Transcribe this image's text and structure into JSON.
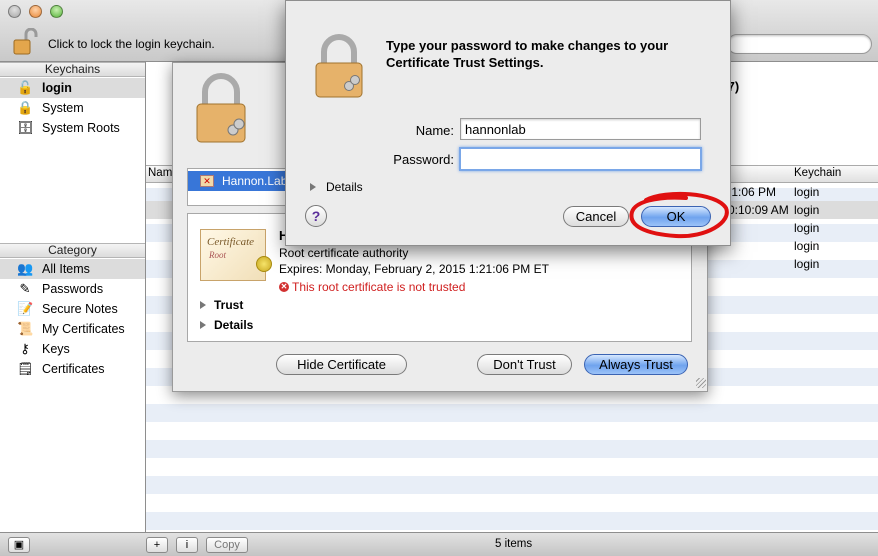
{
  "window": {
    "lock_text": "Click to lock the login keychain.",
    "bottom_status": "5 items",
    "copy_label": "Copy",
    "add_label": "+",
    "info_label": "i"
  },
  "sidebar": {
    "keychains_header": "Keychains",
    "keychains": [
      {
        "label": "login",
        "icon": "unlocked-lock-icon",
        "selected": true
      },
      {
        "label": "System",
        "icon": "lock-icon"
      },
      {
        "label": "System Roots",
        "icon": "cabinet-icon"
      }
    ],
    "category_header": "Category",
    "categories": [
      {
        "label": "All Items",
        "icon": "people-icon",
        "selected": true
      },
      {
        "label": "Passwords",
        "icon": "key-pencil-icon"
      },
      {
        "label": "Secure Notes",
        "icon": "note-icon"
      },
      {
        "label": "My Certificates",
        "icon": "certificate-icon"
      },
      {
        "label": "Keys",
        "icon": "key-icon"
      },
      {
        "label": "Certificates",
        "icon": "certificate-list-icon"
      }
    ]
  },
  "list": {
    "columns": {
      "name": "Nam",
      "keychain": "Keychain"
    },
    "bg_title_right": "E7)",
    "rows": [
      {
        "date": ":1:06 PM",
        "keychain": "login"
      },
      {
        "date": "0:10:09 AM",
        "keychain": "login"
      },
      {
        "date": "",
        "keychain": "login"
      },
      {
        "date": "",
        "keychain": "login"
      },
      {
        "date": "",
        "keychain": "login"
      }
    ]
  },
  "cert_sheet": {
    "selected_item": "Hannon.Lab",
    "cert_image_title": "Certificate",
    "cert_image_sub": "Root",
    "name_partial": "H",
    "type": "Root certificate authority",
    "expires": "Expires: Monday, February 2, 2015 1:21:06 PM ET",
    "error": "This root certificate is not trusted",
    "trust_label": "Trust",
    "details_label": "Details",
    "hide_button": "Hide Certificate",
    "dont_trust_button": "Don't Trust",
    "always_trust_button": "Always Trust",
    "bg_snippets": [
      "D",
      "“H",
      "Th",
      "ch",
      "its"
    ]
  },
  "password_dialog": {
    "title": "Type your password to make changes to your Certificate Trust Settings.",
    "name_label": "Name:",
    "name_value": "hannonlab",
    "password_label": "Password:",
    "password_value": "",
    "details_label": "Details",
    "help_label": "?",
    "cancel_button": "Cancel",
    "ok_button": "OK"
  },
  "colors": {
    "selection_blue": "#3876d8",
    "error_red": "#d02020",
    "annotation_red": "#e01010",
    "stripe_blue": "#e8eef7"
  }
}
